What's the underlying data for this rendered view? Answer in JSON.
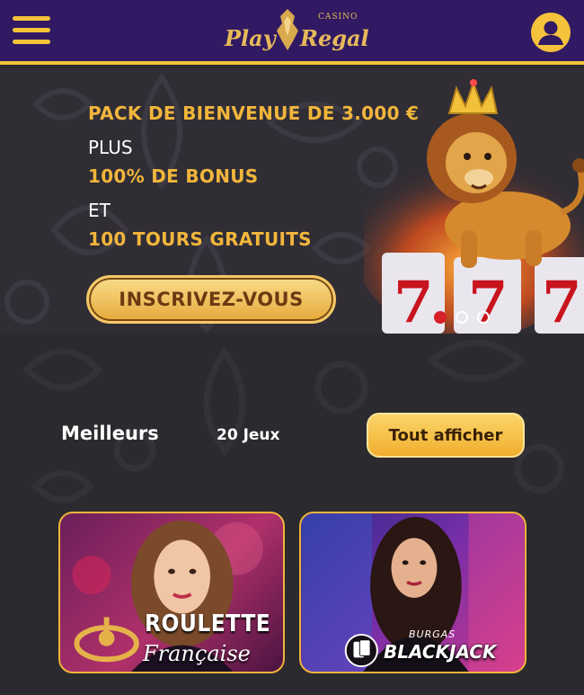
{
  "header": {
    "logo_left": "Play",
    "logo_right": "Regal",
    "logo_small": "CASINO"
  },
  "hero": {
    "line1": "PACK DE BIENVENUE DE 3.000 €",
    "line2": "PLUS",
    "line3": "100% DE BONUS",
    "line4": "ET",
    "line5": "100 TOURS GRATUITS",
    "cta_label": "INSCRIVEZ-VOUS",
    "slides": 3,
    "active_slide": 1
  },
  "section": {
    "title": "Meilleurs",
    "count": "20 Jeux",
    "show_all_label": "Tout afficher"
  },
  "games": [
    {
      "title_line1": "ROULETTE",
      "title_line2": "Française"
    },
    {
      "brand": "BURGAS",
      "title": "BLACKJACK"
    }
  ],
  "colors": {
    "header_bg": "#311a63",
    "accent_gold": "#f3c43b",
    "page_bg": "#2b2a2e",
    "active_dot": "#d6202a"
  },
  "icons": {
    "menu": "hamburger-icon",
    "user": "user-icon"
  }
}
